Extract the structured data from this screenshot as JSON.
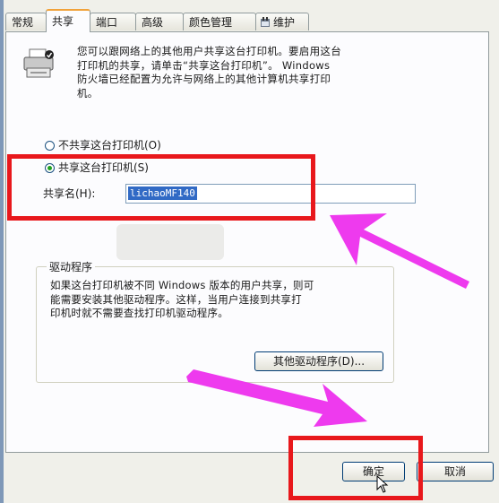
{
  "tabs": [
    {
      "label": "常规"
    },
    {
      "label": "共享"
    },
    {
      "label": "端口"
    },
    {
      "label": "高级"
    },
    {
      "label": "颜色管理"
    },
    {
      "label": "维护"
    }
  ],
  "active_tab": "共享",
  "info": {
    "lines": [
      "您可以跟网络上的其他用户共享这台打印机。要启用这台",
      "打印机的共享，请单击“共享这台打印机”。 Windows",
      "防火墙已经配置为允许与网络上的其他计算机共享打印",
      "机。"
    ]
  },
  "sharing": {
    "no_share_label": "不共享这台打印机(O)",
    "share_label": "共享这台打印机(S)",
    "selected": "share",
    "share_name_label": "共享名(H):",
    "share_name_value": "lichaoMF140"
  },
  "drivers": {
    "title": "驱动程序",
    "lines": [
      "如果这台打印机被不同 Windows 版本的用户共享，则可",
      "能需要安装其他驱动程序。这样，当用户连接到共享打",
      "印机时就不需要查找打印机驱动程序。"
    ],
    "other_drivers_button": "其他驱动程序(D)..."
  },
  "footer": {
    "ok_button": "确定",
    "cancel_button": "取消"
  },
  "colors": {
    "highlight": "#e8181c",
    "arrow": "#ee3aee"
  }
}
